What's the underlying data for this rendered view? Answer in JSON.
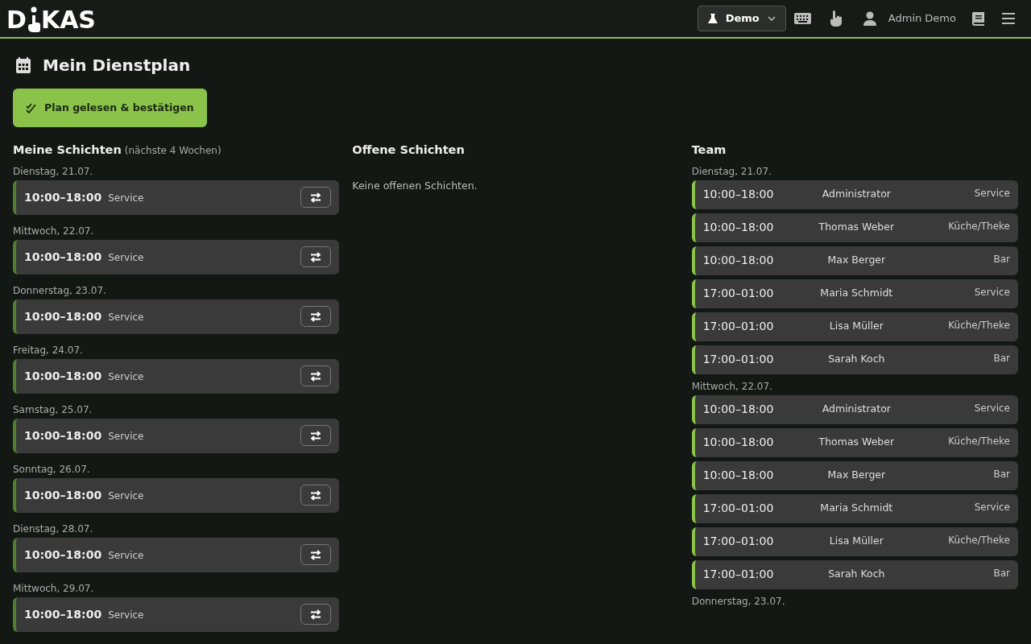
{
  "header": {
    "logo": {
      "first": "D",
      "rest": "KAS"
    },
    "mode_button": "Demo",
    "user": "Admin Demo"
  },
  "page": {
    "title": "Mein Dienstplan",
    "confirm_button": "Plan gelesen & bestätigen"
  },
  "my_shifts": {
    "title": "Meine Schichten",
    "subtitle": "(nächste 4 Wochen)",
    "days": [
      {
        "date": "Dienstag, 21.07.",
        "shifts": [
          {
            "time": "10:00–18:00",
            "role": "Service"
          }
        ]
      },
      {
        "date": "Mittwoch, 22.07.",
        "shifts": [
          {
            "time": "10:00–18:00",
            "role": "Service"
          }
        ]
      },
      {
        "date": "Donnerstag, 23.07.",
        "shifts": [
          {
            "time": "10:00–18:00",
            "role": "Service"
          }
        ]
      },
      {
        "date": "Freitag, 24.07.",
        "shifts": [
          {
            "time": "10:00–18:00",
            "role": "Service"
          }
        ]
      },
      {
        "date": "Samstag, 25.07.",
        "shifts": [
          {
            "time": "10:00–18:00",
            "role": "Service"
          }
        ]
      },
      {
        "date": "Sonntag, 26.07.",
        "shifts": [
          {
            "time": "10:00–18:00",
            "role": "Service"
          }
        ]
      },
      {
        "date": "Dienstag, 28.07.",
        "shifts": [
          {
            "time": "10:00–18:00",
            "role": "Service"
          }
        ]
      },
      {
        "date": "Mittwoch, 29.07.",
        "shifts": [
          {
            "time": "10:00–18:00",
            "role": "Service"
          }
        ]
      }
    ]
  },
  "open_shifts": {
    "title": "Offene Schichten",
    "empty_text": "Keine offenen Schichten."
  },
  "team": {
    "title": "Team",
    "days": [
      {
        "date": "Dienstag, 21.07.",
        "shifts": [
          {
            "time": "10:00–18:00",
            "name": "Administrator",
            "role": "Service"
          },
          {
            "time": "10:00–18:00",
            "name": "Thomas Weber",
            "role": "Küche/Theke"
          },
          {
            "time": "10:00–18:00",
            "name": "Max Berger",
            "role": "Bar"
          },
          {
            "time": "17:00–01:00",
            "name": "Maria Schmidt",
            "role": "Service"
          },
          {
            "time": "17:00–01:00",
            "name": "Lisa Müller",
            "role": "Küche/Theke"
          },
          {
            "time": "17:00–01:00",
            "name": "Sarah Koch",
            "role": "Bar"
          }
        ]
      },
      {
        "date": "Mittwoch, 22.07.",
        "shifts": [
          {
            "time": "10:00–18:00",
            "name": "Administrator",
            "role": "Service"
          },
          {
            "time": "10:00–18:00",
            "name": "Thomas Weber",
            "role": "Küche/Theke"
          },
          {
            "time": "10:00–18:00",
            "name": "Max Berger",
            "role": "Bar"
          },
          {
            "time": "17:00–01:00",
            "name": "Maria Schmidt",
            "role": "Service"
          },
          {
            "time": "17:00–01:00",
            "name": "Lisa Müller",
            "role": "Küche/Theke"
          },
          {
            "time": "17:00–01:00",
            "name": "Sarah Koch",
            "role": "Bar"
          }
        ]
      },
      {
        "date": "Donnerstag, 23.07."
      }
    ]
  }
}
